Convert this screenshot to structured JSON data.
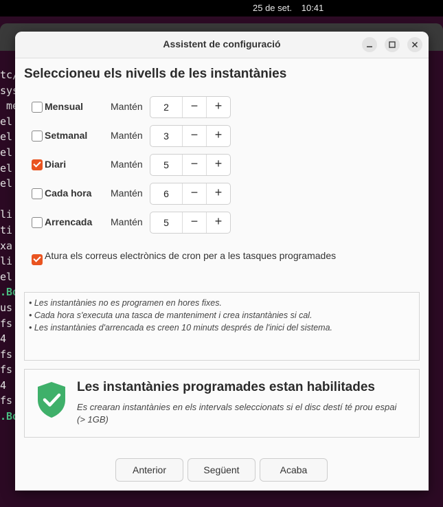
{
  "topbar": {
    "date": "25 de set.",
    "time": "10:41"
  },
  "terminal": {
    "lines": [
      {
        "t": "tc/",
        "c": ""
      },
      {
        "t": "sys",
        "c": ""
      },
      {
        "t": " me",
        "c": ""
      },
      {
        "t": "el",
        "c": ""
      },
      {
        "t": "el",
        "c": ""
      },
      {
        "t": "el",
        "c": ""
      },
      {
        "t": "el",
        "c": ""
      },
      {
        "t": "el",
        "c": ""
      },
      {
        "t": "",
        "c": ""
      },
      {
        "t": "li",
        "c": ""
      },
      {
        "t": "ti",
        "c": ""
      },
      {
        "t": "xa",
        "c": ""
      },
      {
        "t": "li",
        "c": ""
      },
      {
        "t": "el",
        "c": ""
      },
      {
        "t": ".Bo",
        "c": "g"
      },
      {
        "t": "us",
        "c": ""
      },
      {
        "t": "fs",
        "c": ""
      },
      {
        "t": "4",
        "c": ""
      },
      {
        "t": "fs",
        "c": ""
      },
      {
        "t": "fs",
        "c": ""
      },
      {
        "t": "4",
        "c": ""
      },
      {
        "t": "fs",
        "c": ""
      },
      {
        "t": ".Bo",
        "c": "g"
      }
    ]
  },
  "dialog": {
    "title": "Assistent de configuració",
    "heading": "Seleccioneu els nivells de les instantànies",
    "keep_label": "Mantén",
    "levels": [
      {
        "label": "Mensual",
        "checked": false,
        "value": "2"
      },
      {
        "label": "Setmanal",
        "checked": false,
        "value": "3"
      },
      {
        "label": "Diari",
        "checked": true,
        "value": "5"
      },
      {
        "label": "Cada hora",
        "checked": false,
        "value": "6"
      },
      {
        "label": "Arrencada",
        "checked": false,
        "value": "5"
      }
    ],
    "cron": {
      "label": "Atura els correus electrònics de cron per a les tasques programades",
      "checked": true
    },
    "notes": [
      "• Les instantànies no es programen en hores fixes.",
      "• Cada hora s'executa una tasca de manteniment i crea instantànies si cal.",
      "• Les instantànies d'arrencada es creen 10 minuts després de l'inici del sistema."
    ],
    "status": {
      "title": "Les instantànies programades estan habilitades",
      "description": "Es crearan instantànies en els intervals seleccionats si el disc destí té prou espai (> 1GB)"
    },
    "buttons": {
      "previous": "Anterior",
      "next": "Següent",
      "finish": "Acaba"
    },
    "minus_symbol": "−",
    "plus_symbol": "+"
  },
  "colors": {
    "accent": "#e95420",
    "shield": "#3fb06a"
  }
}
